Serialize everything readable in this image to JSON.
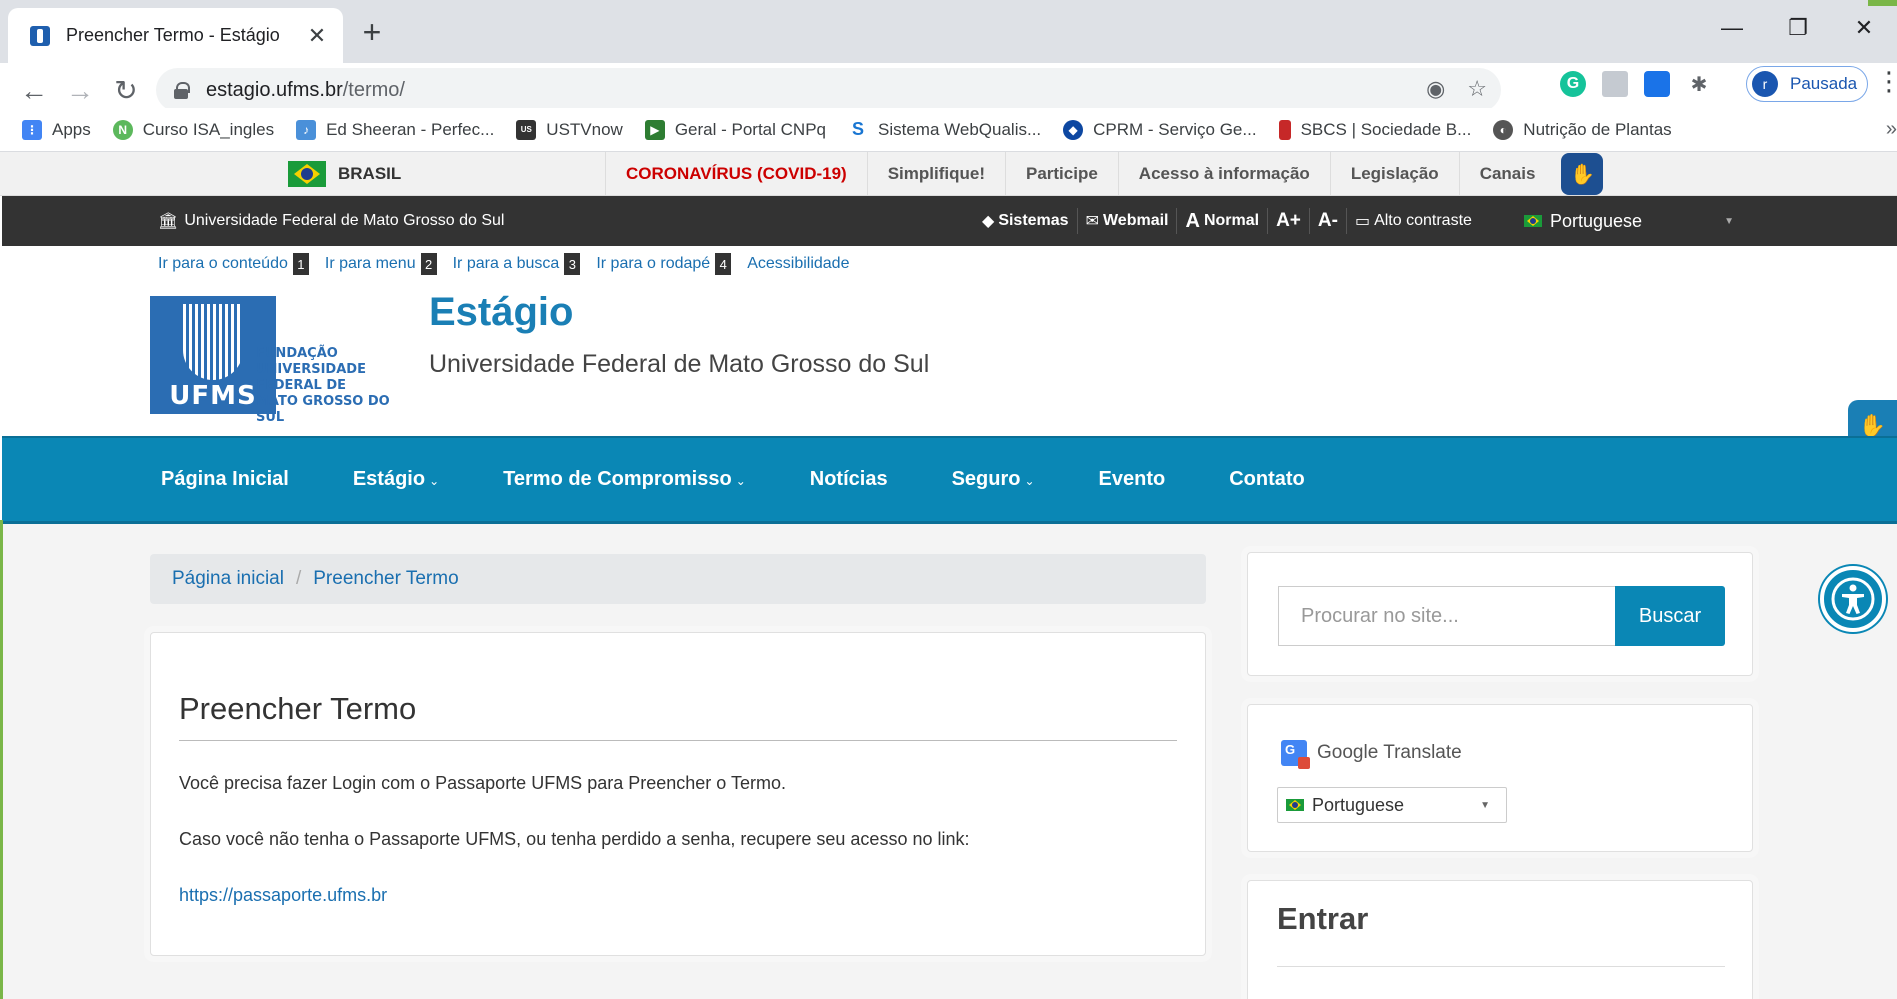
{
  "browser": {
    "tab_title": "Preencher Termo - Estágio",
    "url_host": "estagio.ufms.br",
    "url_path": "/termo/",
    "profile_initial": "r",
    "profile_label": "Pausada",
    "window_buttons": [
      "—",
      "❐",
      "✕"
    ]
  },
  "bookmarks": [
    {
      "label": "Apps",
      "icon": "apps-grid-icon",
      "color": "#4285f4"
    },
    {
      "label": "Curso ISA_ingles",
      "icon": "leaf-icon",
      "color": "#5cb85c"
    },
    {
      "label": "Ed Sheeran - Perfec...",
      "icon": "music-icon",
      "color": "#4a90d9"
    },
    {
      "label": "USTVnow",
      "icon": "tv-icon",
      "color": "#333333"
    },
    {
      "label": "Geral - Portal CNPq",
      "icon": "cnpq-icon",
      "color": "#2e7d32"
    },
    {
      "label": "Sistema WebQualis...",
      "icon": "webqualis-icon",
      "color": "#1976d2"
    },
    {
      "label": "CPRM - Serviço Ge...",
      "icon": "cprm-icon",
      "color": "#0d47a1"
    },
    {
      "label": "SBCS | Sociedade B...",
      "icon": "sbcs-icon",
      "color": "#c62828"
    },
    {
      "label": "Nutrição de Plantas",
      "icon": "globe-icon",
      "color": "#555555"
    }
  ],
  "govbar": {
    "brasil": "BRASIL",
    "links": [
      "CORONAVÍRUS (COVID-19)",
      "Simplifique!",
      "Participe",
      "Acesso à informação",
      "Legislação",
      "Canais"
    ]
  },
  "darkbar": {
    "title": "Universidade Federal de Mato Grosso do Sul",
    "tools": [
      {
        "icon": "◆",
        "label": "Sistemas"
      },
      {
        "icon": "✉",
        "label": "Webmail"
      },
      {
        "icon": "A",
        "label": "Normal"
      },
      {
        "icon": "A+",
        "label": ""
      },
      {
        "icon": "A-",
        "label": ""
      },
      {
        "icon": "▭",
        "label": "Alto contraste"
      }
    ],
    "language": "Portuguese"
  },
  "accessibility_links": [
    {
      "label": "Ir para o conteúdo",
      "key": "1"
    },
    {
      "label": "Ir para menu",
      "key": "2"
    },
    {
      "label": "Ir para a busca",
      "key": "3"
    },
    {
      "label": "Ir para o rodapé",
      "key": "4"
    },
    {
      "label": "Acessibilidade",
      "key": ""
    }
  ],
  "header": {
    "logo_lines": [
      "FUNDAÇÃO",
      "UNIVERSIDADE",
      "FEDERAL DE",
      "MATO GROSSO DO SUL"
    ],
    "logo_abbr": "UFMS",
    "site_title": "Estágio",
    "site_subtitle": "Universidade Federal de Mato Grosso do Sul"
  },
  "mainnav": [
    {
      "label": "Página Inicial",
      "dropdown": false
    },
    {
      "label": "Estágio",
      "dropdown": true
    },
    {
      "label": "Termo de Compromisso",
      "dropdown": true
    },
    {
      "label": "Notícias",
      "dropdown": false
    },
    {
      "label": "Seguro",
      "dropdown": true
    },
    {
      "label": "Evento",
      "dropdown": false
    },
    {
      "label": "Contato",
      "dropdown": false
    }
  ],
  "breadcrumb": {
    "home": "Página inicial",
    "separator": "/",
    "current": "Preencher Termo"
  },
  "article": {
    "title": "Preencher Termo",
    "p1": "Você precisa fazer Login com o Passaporte UFMS para Preencher o Termo.",
    "p2": "Caso você não tenha o Passaporte UFMS, ou tenha perdido a senha, recupere seu acesso no link:",
    "link": "https://passaporte.ufms.br"
  },
  "sidebar": {
    "search_placeholder": "Procurar no site...",
    "search_button": "Buscar",
    "translate_brand": "Google Translate",
    "translate_value": "Portuguese",
    "login_title": "Entrar"
  },
  "colors": {
    "primary": "#0a87b5",
    "link": "#1a6fb0",
    "covid": "#cc0000",
    "dark": "#333333"
  }
}
